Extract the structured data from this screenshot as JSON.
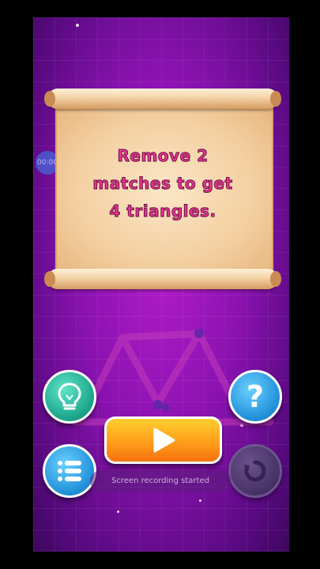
{
  "puzzle": {
    "instruction": "Remove 2\nmatches to get\n4 triangles."
  },
  "timer": {
    "label": "00:00"
  },
  "buttons": {
    "hint": {
      "icon": "lightbulb-icon"
    },
    "help": {
      "icon": "question-icon",
      "glyph": "?"
    },
    "play": {
      "icon": "play-icon"
    },
    "menu": {
      "icon": "list-icon"
    },
    "replay": {
      "icon": "replay-icon"
    }
  },
  "toast": {
    "text": "Screen recording started"
  },
  "colors": {
    "background": "#8a12b0",
    "instruction_text": "#e8358f",
    "play_button": "#ff9e1a",
    "hint_button": "#19a488",
    "help_button": "#1f8fd8"
  }
}
